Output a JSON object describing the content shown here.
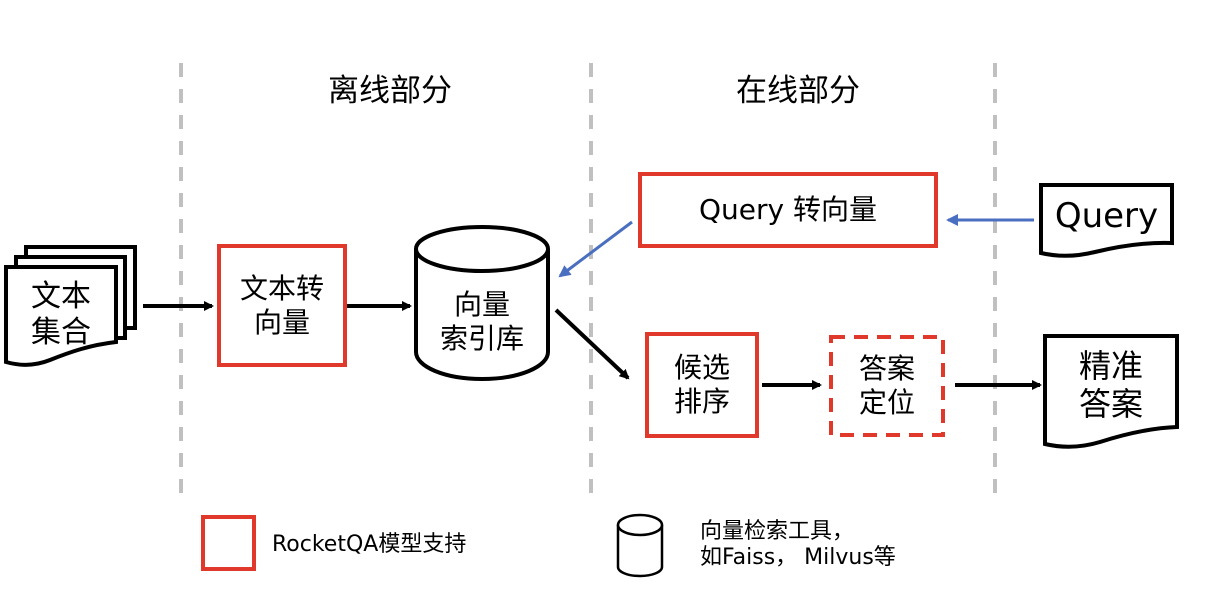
{
  "sections": {
    "offline": "离线部分",
    "online": "在线部分"
  },
  "nodes": {
    "text_collection": "文本\n集合",
    "text_to_vector": "文本转\n向量",
    "vector_index": "向量\n索引库",
    "query_to_vector": "Query 转向量",
    "query": "Query",
    "candidate_ranking": "候选\n排序",
    "answer_locating": "答案\n定位",
    "precise_answer": "精准\n答案"
  },
  "legend": {
    "rocketqa": "RocketQA模型支持",
    "vector_tool": "向量检索工具，\n如Faiss， Milvus等"
  },
  "colors": {
    "red": "#e0392b",
    "blue": "#4a6fc1",
    "divider": "#c0c0c0",
    "black": "#000000"
  }
}
